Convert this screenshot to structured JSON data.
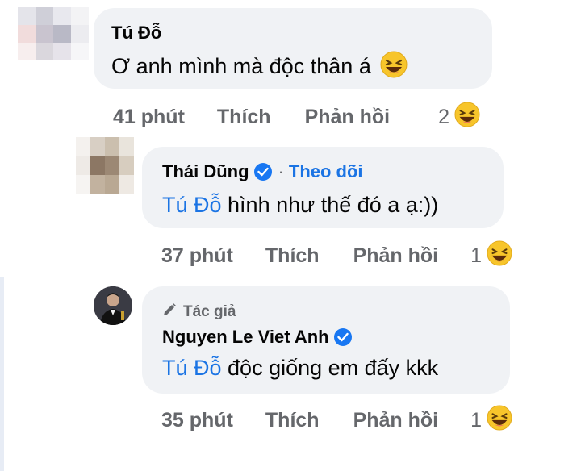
{
  "comments": [
    {
      "name": "Tú Đỗ",
      "text": "Ơ anh mình mà độc thân á",
      "emoji": "laughing-emoji",
      "time_value": "41",
      "time_unit": "phút",
      "like": "Thích",
      "reply": "Phản hồi",
      "reaction_count": "2"
    },
    {
      "name": "Thái Dũng",
      "follow": "Theo dõi",
      "dot": "·",
      "mention": "Tú Đỗ",
      "text": " hình như thế đó a ạ:))",
      "time_value": "37",
      "time_unit": "phút",
      "like": "Thích",
      "reply": "Phản hồi",
      "reaction_count": "1"
    },
    {
      "author_tag": "Tác giả",
      "name": "Nguyen Le Viet Anh",
      "mention": "Tú Đỗ",
      "text": " độc giống em đấy kkk",
      "time_value": "35",
      "time_unit": "phút",
      "like": "Thích",
      "reply": "Phản hồi",
      "reaction_count": "1"
    }
  ],
  "colors": {
    "bubble": "#f0f2f5",
    "mention": "#1b74e4",
    "verified": "#1877f2",
    "muted": "#65676b"
  }
}
